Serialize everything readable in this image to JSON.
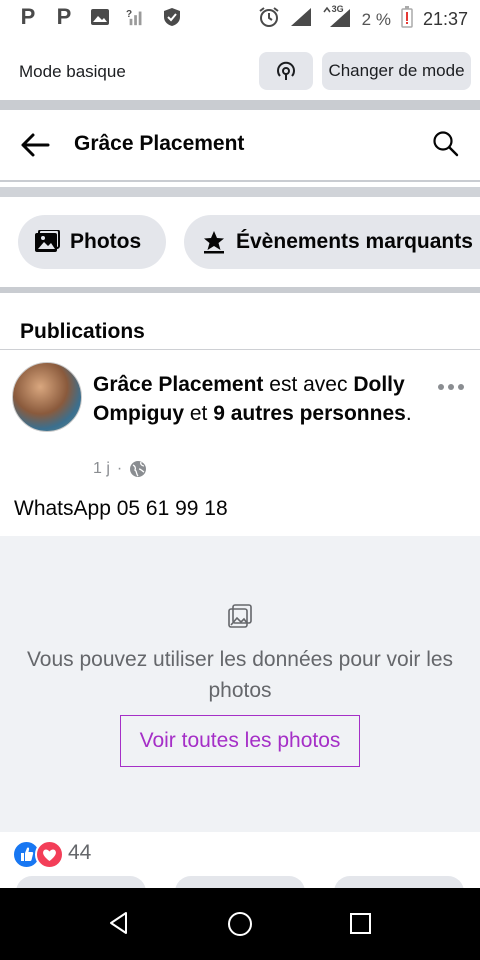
{
  "status_bar": {
    "icons_left": [
      "p-notification-icon",
      "p-notification-icon",
      "image-icon",
      "signal-question-icon",
      "shield-icon"
    ],
    "icons_right": [
      "alarm-icon",
      "signal-icon",
      "signal-3g-icon"
    ],
    "network": "3G",
    "battery": "2 %",
    "time": "21:37"
  },
  "top_bar": {
    "mode_label": "Mode basique",
    "change_mode_label": "Changer de mode"
  },
  "header": {
    "title": "Grâce Placement"
  },
  "pills": [
    {
      "label": "Photos"
    },
    {
      "label": "Évènements marquants"
    }
  ],
  "section_title": "Publications",
  "post": {
    "author": "Grâce Placement",
    "with_text": "est avec",
    "tagged": "Dolly Ompiguy",
    "and_text": "et",
    "others": "9 autres personnes",
    "end_punct": ".",
    "time": "1 j",
    "separator": "·",
    "body": "WhatsApp 05 61 99 18",
    "photo_message": "Vous pouvez utiliser les données pour voir les photos",
    "see_photos_label": "Voir toutes les photos",
    "reaction_count": "44"
  },
  "colors": {
    "accent_purple": "#a52fc7",
    "like_blue": "#1877f2",
    "love_red": "#f33e58",
    "pill_gray": "#e4e6eb",
    "photo_bg": "#f0f2f5"
  }
}
